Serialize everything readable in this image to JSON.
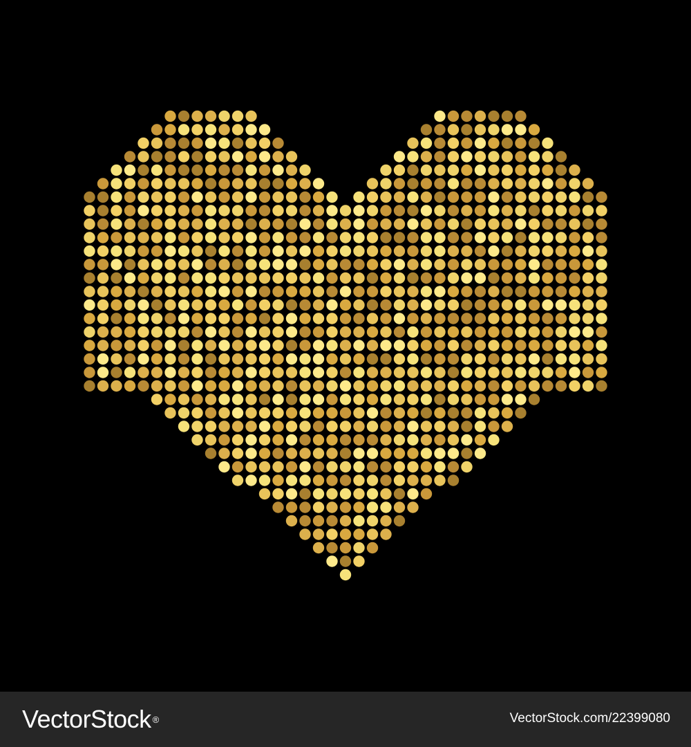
{
  "artwork": {
    "subject": "heart-icon",
    "background": "#000000",
    "dot_palette": [
      "#f6e27a",
      "#e8c35a",
      "#d9a940",
      "#c9983a",
      "#b88a35",
      "#efd36a",
      "#fde98a",
      "#a8802f",
      "#f2d065",
      "#dcb04c"
    ]
  },
  "footer": {
    "background": "#262626",
    "logo_text": "VectorStock",
    "registered_mark": "®",
    "image_id_text": "VectorStock.com/22399080"
  }
}
